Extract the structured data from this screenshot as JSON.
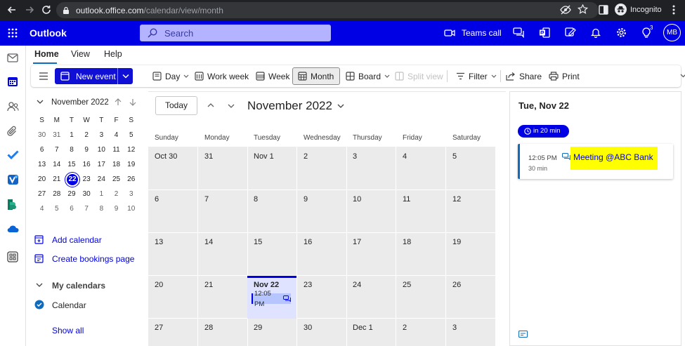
{
  "browser": {
    "url_host": "outlook.office.com",
    "url_path": "/calendar/view/month",
    "incognito_label": "Incognito"
  },
  "header": {
    "brand": "Outlook",
    "search_placeholder": "Search",
    "teams_call": "Teams call",
    "notification_count": "3",
    "avatar_initials": "MB"
  },
  "tabs": [
    "Home",
    "View",
    "Help"
  ],
  "ribbon": {
    "new_event": "New event",
    "day": "Day",
    "work_week": "Work week",
    "week": "Week",
    "month": "Month",
    "board": "Board",
    "split_view": "Split view",
    "filter": "Filter",
    "share": "Share",
    "print": "Print"
  },
  "minical": {
    "title": "November 2022",
    "weekdays": [
      "S",
      "M",
      "T",
      "W",
      "T",
      "F",
      "S"
    ],
    "weeks": [
      [
        "30",
        "31",
        "1",
        "2",
        "3",
        "4",
        "5"
      ],
      [
        "6",
        "7",
        "8",
        "9",
        "10",
        "11",
        "12"
      ],
      [
        "13",
        "14",
        "15",
        "16",
        "17",
        "18",
        "19"
      ],
      [
        "20",
        "21",
        "22",
        "23",
        "24",
        "25",
        "26"
      ],
      [
        "27",
        "28",
        "29",
        "30",
        "1",
        "2",
        "3"
      ],
      [
        "4",
        "5",
        "6",
        "7",
        "8",
        "9",
        "10"
      ]
    ],
    "selected": "22"
  },
  "leftpane": {
    "add_calendar": "Add calendar",
    "create_bookings": "Create bookings page",
    "my_calendars": "My calendars",
    "calendar": "Calendar",
    "show_all": "Show all"
  },
  "calendar": {
    "today_button": "Today",
    "title": "November 2022",
    "weekdays": [
      "Sunday",
      "Monday",
      "Tuesday",
      "Wednesday",
      "Thursday",
      "Friday",
      "Saturday"
    ],
    "weeks": [
      [
        "Oct 30",
        "31",
        "Nov 1",
        "2",
        "3",
        "4",
        "5"
      ],
      [
        "6",
        "7",
        "8",
        "9",
        "10",
        "11",
        "12"
      ],
      [
        "13",
        "14",
        "15",
        "16",
        "17",
        "18",
        "19"
      ],
      [
        "20",
        "21",
        "Nov 22",
        "23",
        "24",
        "25",
        "26"
      ],
      [
        "27",
        "28",
        "29",
        "30",
        "Dec 1",
        "2",
        "3"
      ]
    ],
    "event_chip_time": "12:05 PM"
  },
  "agenda": {
    "date": "Tue, Nov 22",
    "countdown": "in 20 min",
    "event_time": "12:05 PM",
    "event_duration": "30 min",
    "event_title": "Meeting @ABC Bank"
  },
  "colors": {
    "brand": "#0000e5",
    "highlight": "#ffff00",
    "today_bg": "#dfe3ff"
  }
}
